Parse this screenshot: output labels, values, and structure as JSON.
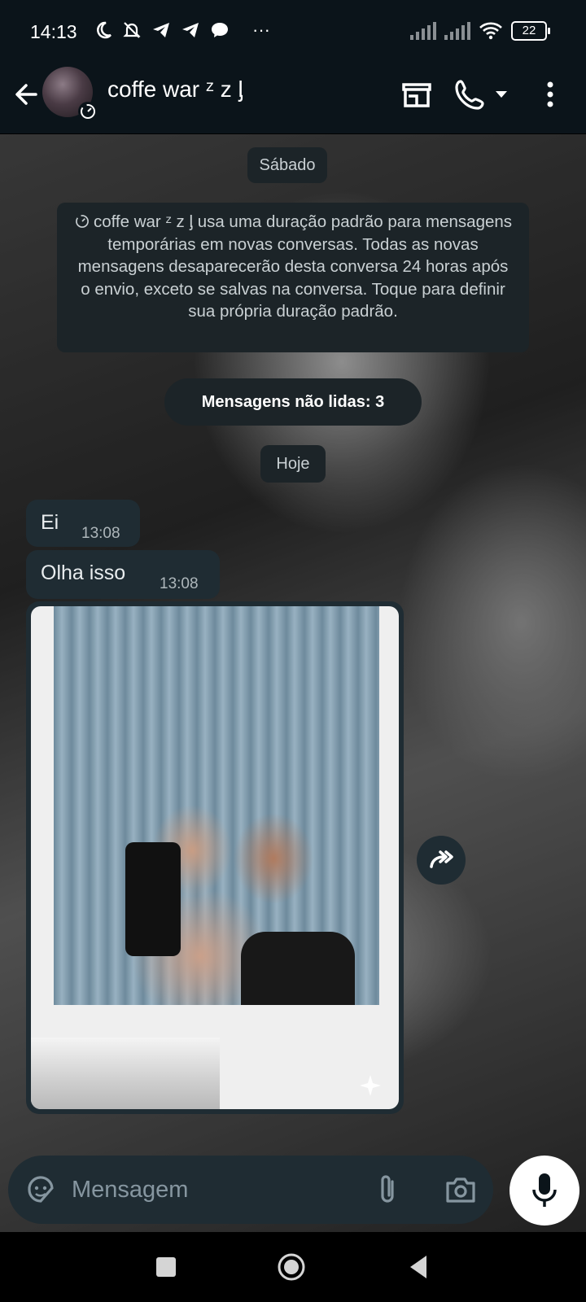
{
  "status_bar": {
    "time": "14:13",
    "more": "···",
    "battery": "22"
  },
  "header": {
    "contact_name": "coffe war ᶻ z ᶅ"
  },
  "chat": {
    "date_saturday": "Sábado",
    "system_message": "coffe war ᶻ z ᶅ usa uma duração padrão para mensagens temporárias em novas conversas. Todas as novas mensagens desaparecerão desta conversa 24 horas após o envio, exceto se salvas na conversa. Toque para definir sua própria duração padrão.",
    "unread_banner": "Mensagens não lidas: 3",
    "date_today": "Hoje",
    "messages": [
      {
        "text": "Ei",
        "time": "13:08"
      },
      {
        "text": "Olha isso",
        "time": "13:08"
      }
    ]
  },
  "input": {
    "placeholder": "Mensagem"
  },
  "colors": {
    "bg": "#0b141a",
    "bubble": "#1f2c33",
    "system": "#1c2428",
    "muted": "#8696a0"
  }
}
